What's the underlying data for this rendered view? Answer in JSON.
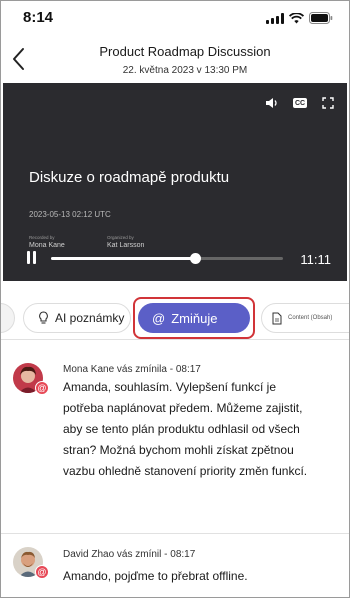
{
  "status_bar": {
    "time": "8:14"
  },
  "header": {
    "title": "Product Roadmap Discussion",
    "subtitle": "22. května 2023 v 13:30 PM"
  },
  "video": {
    "title": "Diskuze o roadmapě produktu",
    "date": "2023-05-13 02:12 UTC",
    "recorded_by_label": "Recorded by",
    "recorded_by": "Mona Kane",
    "organized_by_label": "Organized by",
    "organized_by": "Kat Larsson",
    "cc_label": "CC",
    "duration": "11:11",
    "progress": 0.62
  },
  "tabs": {
    "ai_notes": "AI poznámky",
    "mentions": "Zmiňuje",
    "content": "Content (Obsah)"
  },
  "feed": [
    {
      "meta": "Mona Kane vás zmínila - 08:17",
      "message": "Amanda, souhlasím. Vylepšení funkcí je potřeba naplánovat předem. Můžeme zajistit, aby se tento plán produktu odhlasil od všech stran? Možná bychom mohli získat zpětnou vazbu ohledně stanovení priority změn funkcí."
    },
    {
      "meta": "David Zhao vás zmínil - 08:17",
      "message": "Amando, pojďme to přebrat offline."
    }
  ],
  "colors": {
    "accent": "#5b5fc7",
    "highlight": "#d13438",
    "badge": "#e74856",
    "video_bg": "#2b2b2f"
  },
  "icons": [
    "back-chevron-icon",
    "speaker-icon",
    "cc-icon",
    "fullscreen-icon",
    "pause-icon",
    "lightbulb-icon",
    "at-mention-icon",
    "document-icon",
    "mention-badge-icon"
  ]
}
